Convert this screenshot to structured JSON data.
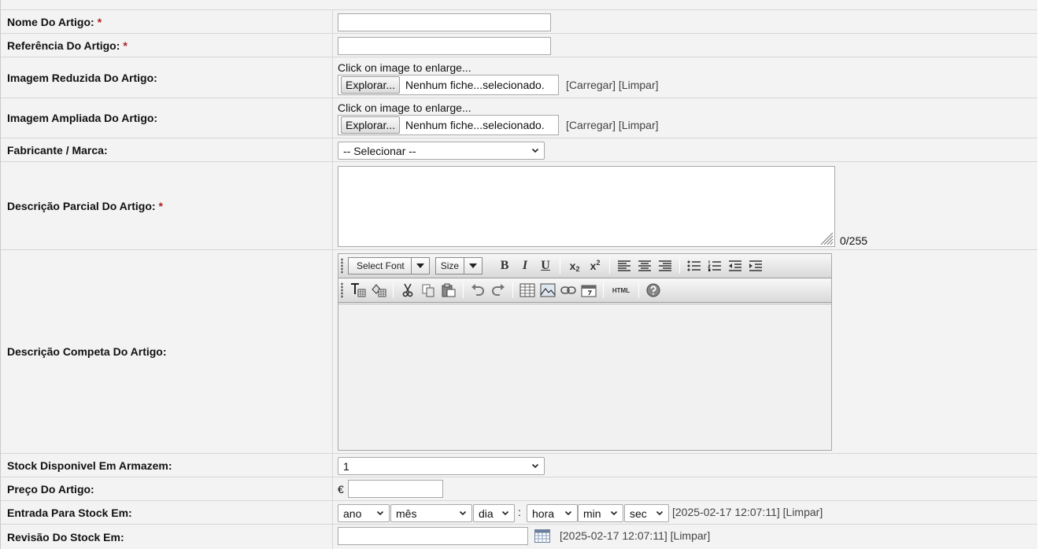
{
  "form": {
    "rows": {
      "nome": {
        "label": "Nome Do Artigo:",
        "required": "*",
        "value": ""
      },
      "referencia": {
        "label": "Referência Do Artigo:",
        "required": "*",
        "value": ""
      },
      "imagem_reduzida": {
        "label": "Imagem Reduzida Do Artigo:",
        "hint": "Click on image to enlarge...",
        "browse_label": "Explorar...",
        "file_status": "Nenhum fiche...selecionado.",
        "upload_link": "[Carregar]",
        "clear_link": "[Limpar]"
      },
      "imagem_ampliada": {
        "label": "Imagem Ampliada Do Artigo:",
        "hint": "Click on image to enlarge...",
        "browse_label": "Explorar...",
        "file_status": "Nenhum fiche...selecionado.",
        "upload_link": "[Carregar]",
        "clear_link": "[Limpar]"
      },
      "fabricante": {
        "label": "Fabricante / Marca:",
        "selected": "-- Selecionar --"
      },
      "descricao_parcial": {
        "label": "Descrição Parcial Do Artigo:",
        "required": "*",
        "value": "",
        "counter": "0/255"
      },
      "descricao_completa": {
        "label": "Descrição Competa Do Artigo:",
        "font_combo": "Select Font",
        "size_combo": "Size",
        "html_button": "HTML"
      },
      "stock": {
        "label": "Stock Disponivel Em Armazem:",
        "selected": "1"
      },
      "preco": {
        "label": "Preço Do Artigo:",
        "currency": "€",
        "value": ""
      },
      "entrada": {
        "label": "Entrada Para Stock Em:",
        "year": "ano",
        "month": "mês",
        "day": "dia",
        "colon": ":",
        "hour": "hora",
        "minute": "min",
        "second": "sec",
        "timestamp": "[2025-02-17 12:07:11]",
        "clear_link": "[Limpar]"
      },
      "revisao": {
        "label": "Revisão Do Stock Em:",
        "value": "",
        "timestamp": "[2025-02-17 12:07:11]",
        "clear_link": "[Limpar]"
      }
    }
  },
  "icons": {
    "toolbar_row1": [
      "bold-icon",
      "italic-icon",
      "underline-icon",
      "subscript-icon",
      "superscript-icon",
      "align-left-icon",
      "align-center-icon",
      "align-right-icon",
      "unordered-list-icon",
      "ordered-list-icon",
      "outdent-icon",
      "indent-icon"
    ],
    "toolbar_row2": [
      "text-color-icon",
      "background-color-icon",
      "cut-icon",
      "copy-icon",
      "paste-icon",
      "undo-icon",
      "redo-icon",
      "table-icon",
      "image-icon",
      "link-icon",
      "date-icon",
      "html-icon",
      "help-icon"
    ],
    "calendar": "calendar-icon"
  },
  "colors": {
    "row_bg": "#f3f3f3",
    "border": "#d6d6d6",
    "required": "#b02020",
    "link_text": "#444444"
  }
}
